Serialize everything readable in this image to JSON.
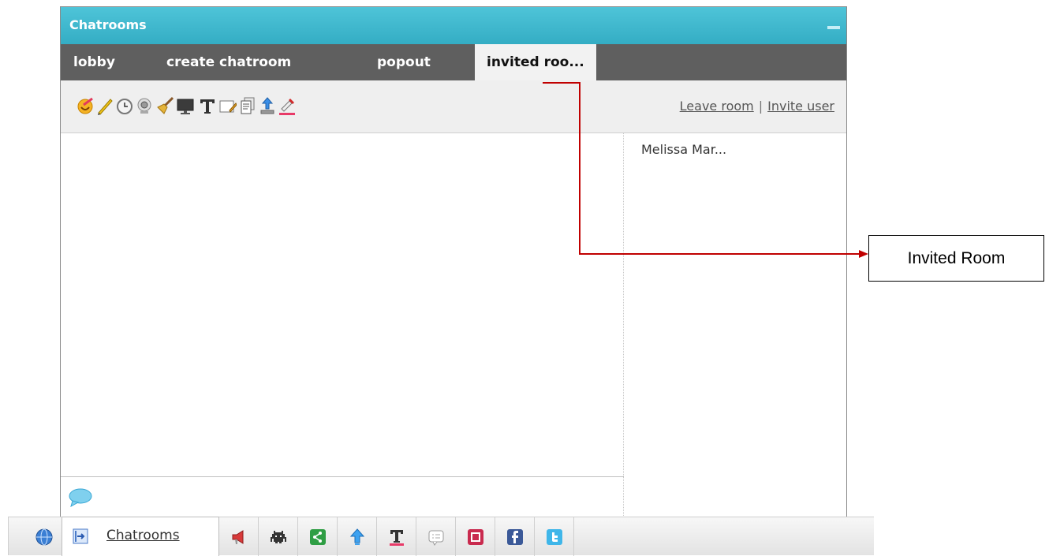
{
  "window": {
    "title": "Chatrooms",
    "tabs": [
      {
        "label": "lobby"
      },
      {
        "label": "create chatroom"
      },
      {
        "label": "popout"
      },
      {
        "label": "invited roo...",
        "active": true
      }
    ],
    "toolbar": {
      "icons": [
        "smiley-icon",
        "pencil-icon",
        "clock-icon",
        "webcam-icon",
        "broom-icon",
        "monitor-icon",
        "text-icon",
        "whiteboard-icon",
        "document-icon",
        "upload-icon",
        "color-picker-icon"
      ],
      "leave_room": "Leave room",
      "separator": "|",
      "invite_user": "Invite user"
    },
    "users": [
      "Melissa Mar..."
    ]
  },
  "bottom_bar": {
    "chatrooms_label": "Chatrooms",
    "icons": [
      "globe-icon",
      "chatrooms-icon",
      "announcement-icon",
      "game-icon",
      "share-icon",
      "upload-arrow-icon",
      "text-format-icon",
      "chat-log-icon",
      "square-app-icon",
      "facebook-icon",
      "twitter-icon"
    ]
  },
  "annotation": {
    "label": "Invited Room"
  },
  "colors": {
    "titlebar": "#4ec4d8",
    "tabbar": "#5f5f5f",
    "annotation_line": "#c00000"
  }
}
